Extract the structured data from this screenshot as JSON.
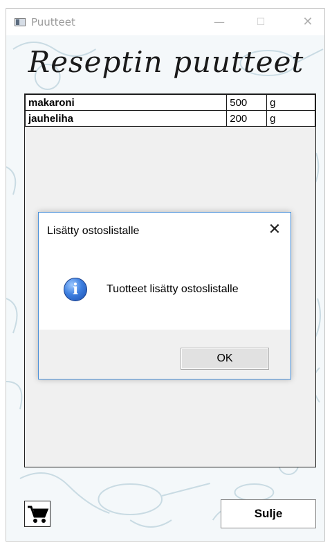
{
  "window": {
    "title": "Puutteet",
    "controls": {
      "minimize": "—",
      "maximize": "☐",
      "close": "✕"
    }
  },
  "heading": "Reseptin puutteet",
  "items": [
    {
      "name": "makaroni",
      "quantity": "500",
      "unit": "g"
    },
    {
      "name": "jauheliha",
      "quantity": "200",
      "unit": "g"
    }
  ],
  "dialog": {
    "title": "Lisätty ostoslistalle",
    "close_glyph": "✕",
    "icon": "information-icon",
    "icon_glyph": "i",
    "message": "Tuotteet lisätty ostoslistalle",
    "ok_label": "OK"
  },
  "footer": {
    "cart_icon": "shopping-cart-icon",
    "close_label": "Sulje"
  },
  "colors": {
    "dialog_border": "#4a90d9",
    "background": "#f4f8fa",
    "doodle_stroke": "#c9dbe3"
  }
}
